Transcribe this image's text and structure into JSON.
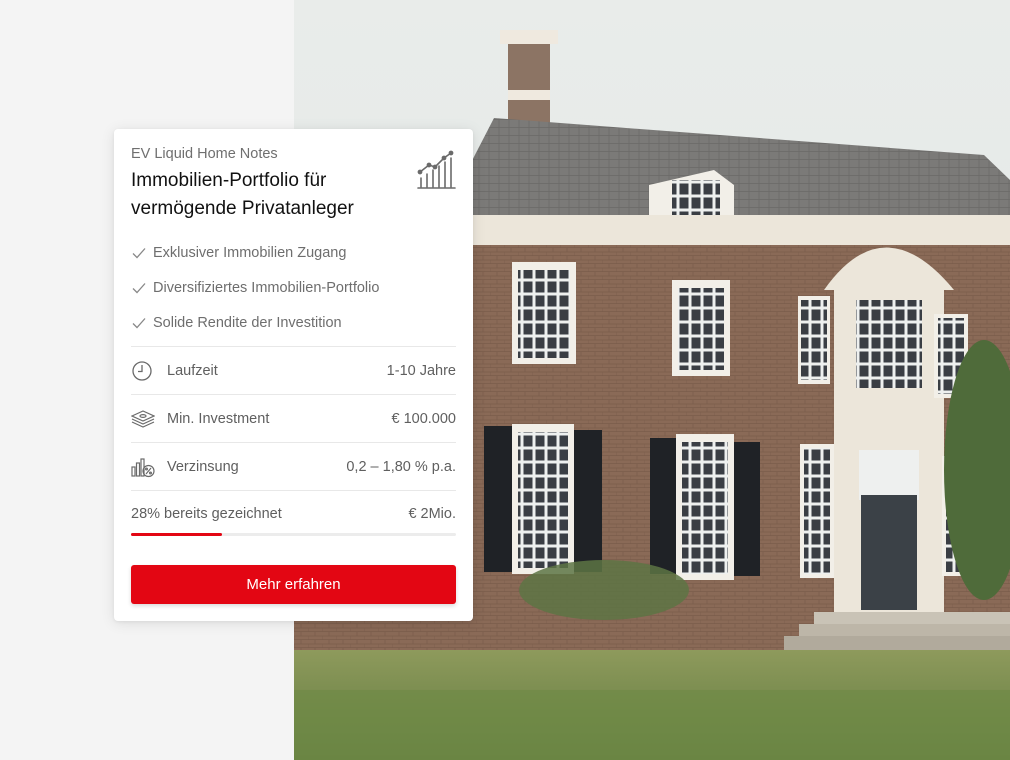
{
  "card": {
    "eyebrow": "EV Liquid Home Notes",
    "title": "Immobilien-Portfolio für vermögende Privatanleger",
    "icon": "growth-chart-icon",
    "features": [
      "Exklusiver Immobilien Zugang",
      "Diversifiziertes Immobilien-Portfolio",
      "Solide Rendite der Investition"
    ],
    "details": [
      {
        "icon": "clock-icon",
        "label": "Laufzeit",
        "value": "1-10 Jahre"
      },
      {
        "icon": "money-stack-icon",
        "label": "Min. Investment",
        "value": "€ 100.000"
      },
      {
        "icon": "interest-rate-icon",
        "label": "Verzinsung",
        "value": "0,2 – 1,80 % p.a."
      }
    ],
    "subscription": {
      "label": "28% bereits gezeichnet",
      "amount": "€ 2Mio.",
      "progress_percent": 28
    },
    "cta_label": "Mehr erfahren"
  },
  "colors": {
    "accent": "#e30613",
    "page_background": "#f4f4f4"
  }
}
